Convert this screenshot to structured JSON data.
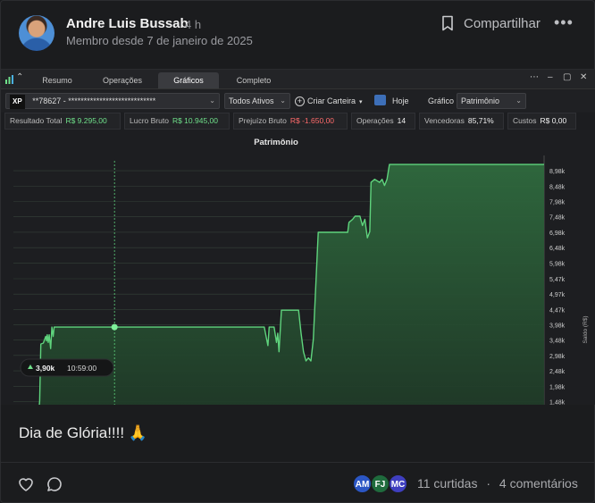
{
  "post": {
    "author": "Andre Luis Bussab",
    "time_ago": "4 h",
    "member_since": "Membro desde 7 de janeiro de 2025",
    "share_label": "Compartilhar",
    "more_label": "•••",
    "body": "Dia de Glória!!!! 🙏",
    "reactors": [
      "AM",
      "FJ",
      "MC"
    ],
    "reactor_colors": [
      "#2b56c4",
      "#1f6b3d",
      "#3f3fbf"
    ],
    "likes": "11 curtidas",
    "separator": "·",
    "comments": "4 comentários"
  },
  "app": {
    "tabs": [
      "Resumo",
      "Operações",
      "Gráficos",
      "Completo"
    ],
    "active_tab": "Gráficos",
    "window_controls": [
      "⋯",
      "–",
      "▢",
      "✕"
    ],
    "toolbar": {
      "broker": "XP",
      "account": "**78627 - ****************************",
      "assets_filter": "Todos Ativos",
      "create_portfolio": "Criar Carteira",
      "date_label": "Hoje",
      "chart_label": "Gráfico",
      "chart_select": "Patrimônio"
    },
    "stats": [
      {
        "label": "Resultado Total",
        "value": "R$ 9.295,00",
        "color": "green"
      },
      {
        "label": "Lucro Bruto",
        "value": "R$ 10.945,00",
        "color": "green"
      },
      {
        "label": "Prejuízo Bruto",
        "value": "R$ -1.650,00",
        "color": "red"
      },
      {
        "label": "Operações",
        "value": "14",
        "color": "white"
      },
      {
        "label": "Vencedoras",
        "value": "85,71%",
        "color": "white"
      },
      {
        "label": "Custos",
        "value": "R$ 0,00",
        "color": "white"
      }
    ]
  },
  "chart_data": {
    "type": "area",
    "title": "Patrimônio",
    "ylabel": "Saldo (R$)",
    "y_ticks": [
      "8,98k",
      "8,48k",
      "7,98k",
      "7,48k",
      "6,98k",
      "6,48k",
      "5,98k",
      "5,47k",
      "4,97k",
      "4,47k",
      "3,98k",
      "3,48k",
      "2,98k",
      "2,48k",
      "1,98k",
      "1,48k"
    ],
    "y_tick_values": [
      8980,
      8480,
      7980,
      7480,
      6980,
      6480,
      5980,
      5470,
      4970,
      4470,
      3980,
      3480,
      2980,
      2480,
      1980,
      1480
    ],
    "ylim": [
      1350,
      9300
    ],
    "tooltip": {
      "value": "3,90k",
      "time": "10:59:00"
    },
    "color": "#5fd47d",
    "points": [
      [
        0,
        1000
      ],
      [
        0.5,
        1500
      ],
      [
        1,
        3350
      ],
      [
        2,
        3380
      ],
      [
        3,
        3600
      ],
      [
        3.3,
        3450
      ],
      [
        3.6,
        3650
      ],
      [
        4,
        3400
      ],
      [
        4.4,
        3650
      ],
      [
        5,
        3200
      ],
      [
        5.5,
        3900
      ],
      [
        6,
        3600
      ],
      [
        6.4,
        3900
      ],
      [
        7,
        3900
      ],
      [
        20,
        3900
      ],
      [
        40,
        3900
      ],
      [
        60,
        3900
      ],
      [
        80,
        3900
      ],
      [
        92,
        3900
      ],
      [
        93,
        3500
      ],
      [
        93.5,
        3300
      ],
      [
        94,
        3900
      ],
      [
        96,
        3900
      ],
      [
        97,
        3400
      ],
      [
        97.5,
        3700
      ],
      [
        98,
        3100
      ],
      [
        99,
        4450
      ],
      [
        102,
        4450
      ],
      [
        106,
        4450
      ],
      [
        107,
        3700
      ],
      [
        108,
        3100
      ],
      [
        109,
        2800
      ],
      [
        110,
        2900
      ],
      [
        111,
        2800
      ],
      [
        112,
        3500
      ],
      [
        114,
        6980
      ],
      [
        116,
        6980
      ],
      [
        122,
        6980
      ],
      [
        126,
        6980
      ],
      [
        126.5,
        7300
      ],
      [
        128,
        7400
      ],
      [
        129,
        7500
      ],
      [
        131,
        7500
      ],
      [
        132,
        7200
      ],
      [
        133,
        7400
      ],
      [
        134,
        6800
      ],
      [
        135,
        7000
      ],
      [
        135.5,
        8600
      ],
      [
        137,
        8700
      ],
      [
        139,
        8600
      ],
      [
        140,
        8700
      ],
      [
        141,
        8500
      ],
      [
        142,
        8700
      ],
      [
        143,
        9180
      ],
      [
        150,
        9180
      ],
      [
        170,
        9180
      ],
      [
        200,
        9180
      ],
      [
        206,
        9180
      ]
    ],
    "x_max": 206,
    "cursor_x": 31,
    "grid": true
  }
}
